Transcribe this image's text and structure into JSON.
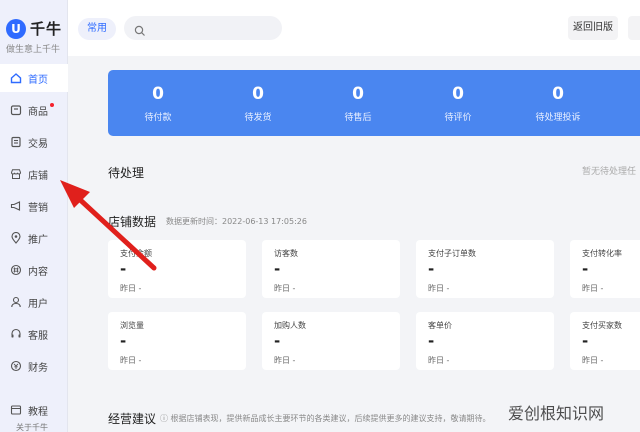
{
  "brand": {
    "name": "千牛",
    "logo_char": "U",
    "slogan": "做生意上千牛",
    "accent_color": "#2f6bff"
  },
  "sidebar": {
    "items": [
      {
        "label": "首页",
        "icon": "home-icon",
        "active": true
      },
      {
        "label": "商品",
        "icon": "goods-icon",
        "badge": "red-dot"
      },
      {
        "label": "交易",
        "icon": "trade-icon"
      },
      {
        "label": "店铺",
        "icon": "store-icon"
      },
      {
        "label": "营销",
        "icon": "megaphone-icon"
      },
      {
        "label": "推广",
        "icon": "location-icon"
      },
      {
        "label": "内容",
        "icon": "content-icon"
      },
      {
        "label": "用户",
        "icon": "user-icon"
      },
      {
        "label": "客服",
        "icon": "headset-icon"
      },
      {
        "label": "财务",
        "icon": "finance-icon"
      },
      {
        "label": "教程",
        "icon": "tutorial-icon"
      }
    ],
    "bottom_text": "关于千牛"
  },
  "topbar": {
    "common_label": "常用",
    "search_placeholder": "",
    "old_version_label": "返回旧版"
  },
  "stats": [
    {
      "value": "0",
      "label": "待付款"
    },
    {
      "value": "0",
      "label": "待发货"
    },
    {
      "value": "0",
      "label": "待售后"
    },
    {
      "value": "0",
      "label": "待评价"
    },
    {
      "value": "0",
      "label": "待处理投诉"
    }
  ],
  "pending": {
    "title": "待处理",
    "empty_text": "暂无待处理任"
  },
  "store_data": {
    "title": "店铺数据",
    "update_time": "数据更新时间：2022-06-13 17:05:26",
    "cards": [
      {
        "label": "支付金额",
        "value": "-",
        "sub": "昨日 -"
      },
      {
        "label": "访客数",
        "value": "-",
        "sub": "昨日 -"
      },
      {
        "label": "支付子订单数",
        "value": "-",
        "sub": "昨日 -"
      },
      {
        "label": "支付转化率",
        "value": "-",
        "sub": "昨日 -"
      },
      {
        "label": "浏览量",
        "value": "-",
        "sub": "昨日 -"
      },
      {
        "label": "加购人数",
        "value": "-",
        "sub": "昨日 -"
      },
      {
        "label": "客单价",
        "value": "-",
        "sub": "昨日 -"
      },
      {
        "label": "支付买家数",
        "value": "-",
        "sub": "昨日 -"
      }
    ]
  },
  "advice": {
    "title": "经营建议",
    "note": "ⓘ 根据店铺表现，提供新品成长主要环节的各类建议，后续提供更多的建议支持，敬请期待。"
  },
  "annotation": {
    "arrow_color": "#e0201c"
  },
  "watermark": "爱创根知识网"
}
